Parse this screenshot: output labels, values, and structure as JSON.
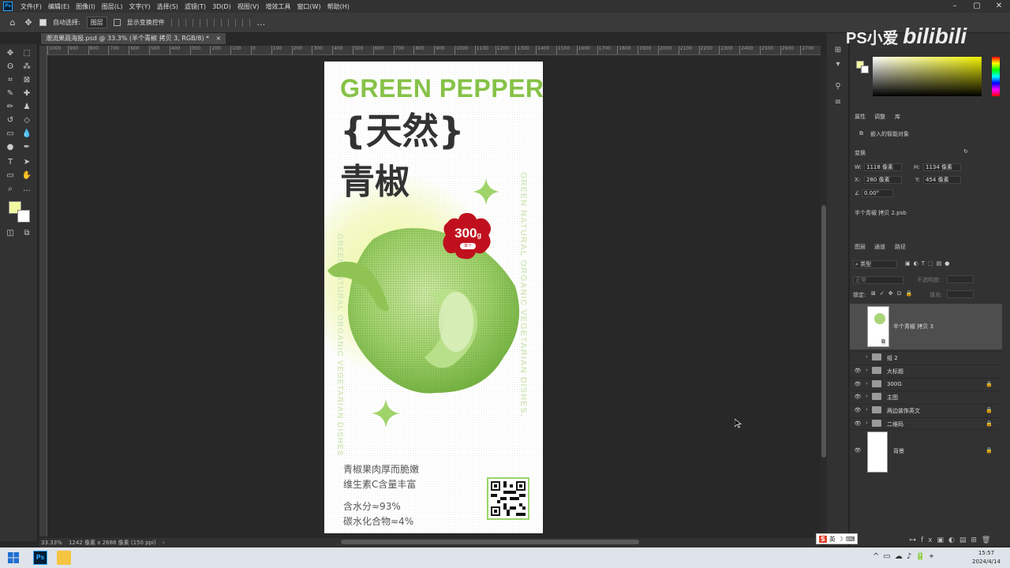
{
  "app": {
    "menus": [
      "文件(F)",
      "编辑(E)",
      "图像(I)",
      "图层(L)",
      "文字(Y)",
      "选择(S)",
      "滤镜(T)",
      "3D(D)",
      "视图(V)",
      "增效工具",
      "窗口(W)",
      "帮助(H)"
    ]
  },
  "options": {
    "auto_select_label": "自动选择:",
    "auto_select_value": "图层",
    "show_transform_label": "显示变换控件"
  },
  "document": {
    "tab_title": "潮流果蔬海报.psd @ 33.3% (半个青椒 拷贝 3, RGB/8) *",
    "ruler_ticks": [
      "1000",
      "900",
      "800",
      "700",
      "600",
      "500",
      "400",
      "300",
      "200",
      "100",
      "0",
      "100",
      "200",
      "300",
      "400",
      "500",
      "600",
      "700",
      "800",
      "900",
      "1000",
      "1100",
      "1200",
      "1300",
      "1400",
      "1500",
      "1600",
      "1700",
      "1800",
      "1900",
      "2000",
      "2100",
      "2200",
      "2300",
      "2400",
      "2500",
      "2600",
      "2700"
    ]
  },
  "status": {
    "zoom": "33.33%",
    "size": "1242 像素 x 2688 像素 (150 ppi)"
  },
  "poster": {
    "title": "GREEN PEPPER",
    "headline1": "{天然}",
    "headline2": "青椒",
    "badge_value": "300",
    "badge_unit": "g",
    "badge_sub": "单个",
    "vertical_right": "GREEN NATURAL ORGANIC VEGETARIAN DISHES.",
    "vertical_left": "GREEN NATURAL ORGANIC VEGETARIAN DISHES",
    "desc1": "青椒果肉厚而脆嫩",
    "desc2": "维生素C含量丰富",
    "stat1": "含水分≈93%",
    "stat2": "碳水化合物≈4%"
  },
  "properties": {
    "tabs": [
      "属性",
      "调整",
      "库"
    ],
    "type": "嵌入的智能对象",
    "transform_label": "变换",
    "w_label": "W:",
    "w": "1118 像素",
    "h_label": "H:",
    "h": "1134 像素",
    "x_label": "X:",
    "x": "280 像素",
    "y_label": "Y:",
    "y": "454 像素",
    "angle": "0.00°",
    "linked_file": "半个青椒 拷贝 2.psb"
  },
  "layers_panel": {
    "tabs": [
      "图层",
      "通道",
      "路径"
    ],
    "kind": "类型",
    "blend": "正常",
    "opacity_label": "不透明度:",
    "lock_label": "锁定:",
    "fill_label": "填充:",
    "layers": [
      {
        "name": "半个青椒 拷贝 3",
        "kind": "smart",
        "visible": false,
        "locked": false
      },
      {
        "name": "组 2",
        "kind": "group",
        "visible": false,
        "locked": false
      },
      {
        "name": "大标题",
        "kind": "group",
        "visible": true,
        "locked": false
      },
      {
        "name": "300G",
        "kind": "group",
        "visible": true,
        "locked": true
      },
      {
        "name": "主图",
        "kind": "group",
        "visible": true,
        "locked": false
      },
      {
        "name": "两边装饰英文",
        "kind": "group",
        "visible": true,
        "locked": true
      },
      {
        "name": "二维码",
        "kind": "group",
        "visible": true,
        "locked": true
      },
      {
        "name": "背景",
        "kind": "background",
        "visible": true,
        "locked": true
      }
    ]
  },
  "watermark": {
    "text": "PS小爱",
    "brand": "bilibili"
  },
  "taskbar": {
    "time": "15:57",
    "date": "2024/4/14",
    "ime_lang": "英"
  }
}
